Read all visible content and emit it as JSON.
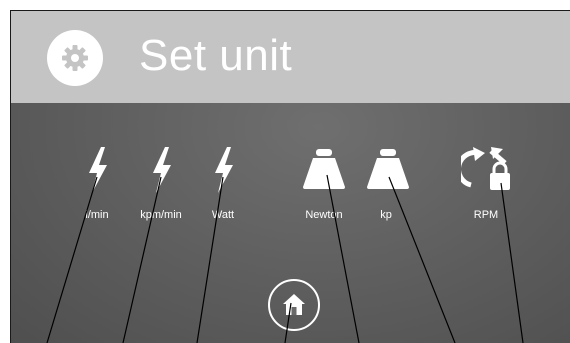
{
  "header": {
    "title": "Set unit",
    "icon": "gear-icon"
  },
  "units": [
    {
      "label": "l/min",
      "icon": "lightning-icon"
    },
    {
      "label": "kpm/min",
      "icon": "lightning-icon"
    },
    {
      "label": "Watt",
      "icon": "lightning-icon"
    },
    {
      "label": "Newton",
      "icon": "weight-icon"
    },
    {
      "label": "kp",
      "icon": "weight-icon"
    },
    {
      "label": "RPM",
      "icon": "rotate-lock-icon"
    }
  ],
  "home": {
    "icon": "home-icon"
  },
  "colors": {
    "header_bg": "#c4c4c4",
    "panel_bg": "#5d5d5d",
    "foreground": "#ffffff"
  }
}
